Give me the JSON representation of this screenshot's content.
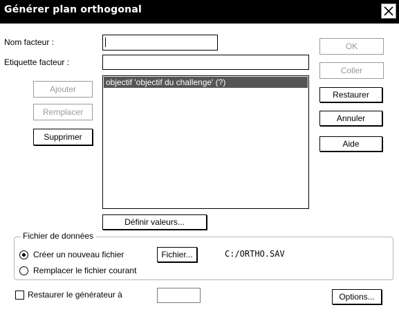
{
  "window": {
    "title": "Générer plan orthogonal"
  },
  "fields": {
    "factor_name_label": "Nom facteur :",
    "factor_name_value": "",
    "factor_label_label": "Etiquette facteur :",
    "factor_label_value": ""
  },
  "left_buttons": {
    "add": "Ajouter",
    "replace": "Remplacer",
    "delete": "Supprimer"
  },
  "factors_list": {
    "items": [
      "objectif 'objectif du challenge' (?)"
    ],
    "selected_index": 0
  },
  "define_values_button": "Définir valeurs...",
  "right_buttons": {
    "ok": "OK",
    "paste": "Coller",
    "reset": "Restaurer",
    "cancel": "Annuler",
    "help": "Aide"
  },
  "data_file": {
    "group_title": "Fichier de données",
    "create_new_label": "Créer un nouveau fichier",
    "replace_current_label": "Remplacer le fichier courant",
    "selected_option": "create_new",
    "file_button": "Fichier...",
    "file_path": "C:/ORTHO.SAV"
  },
  "seed": {
    "label": "Restaurer le générateur à",
    "checked": false,
    "value": ""
  },
  "options_button": "Options...",
  "icons": {
    "close": "close-icon",
    "radio_selected": "radio-selected-icon",
    "radio_unselected": "radio-unselected-icon",
    "checkbox": "checkbox-unchecked-icon"
  }
}
